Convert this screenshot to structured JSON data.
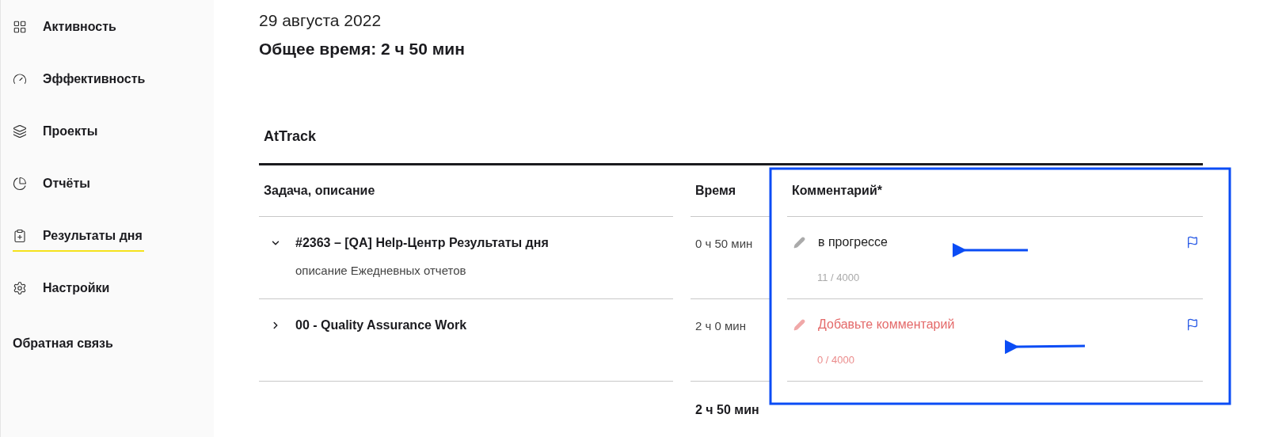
{
  "sidebar": {
    "items": [
      {
        "label": "Активность",
        "selected": false
      },
      {
        "label": "Эффективность",
        "selected": false
      },
      {
        "label": "Проекты",
        "selected": false
      },
      {
        "label": "Отчёты",
        "selected": false
      },
      {
        "label": "Результаты дня",
        "selected": true
      },
      {
        "label": "Настройки",
        "selected": false
      },
      {
        "label": "Обратная связь",
        "selected": false
      }
    ]
  },
  "date": "29 августа 2022",
  "total_title": "Общее время: 2 ч 50 мин",
  "project": "AtTrack",
  "table": {
    "columns": [
      "Задача, описание",
      "Время",
      "Комментарий*"
    ],
    "rows": [
      {
        "title": "#2363 – [QA] Help-Центр Результаты дня",
        "description": "описание Ежедневных отчетов",
        "expanded": true,
        "time": "0 ч 50 мин",
        "comment": {
          "value": "в прогрессе",
          "counter": "11 / 4000",
          "error": false
        }
      },
      {
        "title": "00 - Quality Assurance Work",
        "expanded": false,
        "time": "2 ч 0 мин",
        "comment": {
          "placeholder": "Добавьте комментарий",
          "counter": "0 / 4000",
          "error": true
        }
      }
    ],
    "total": "2 ч 50 мин"
  }
}
